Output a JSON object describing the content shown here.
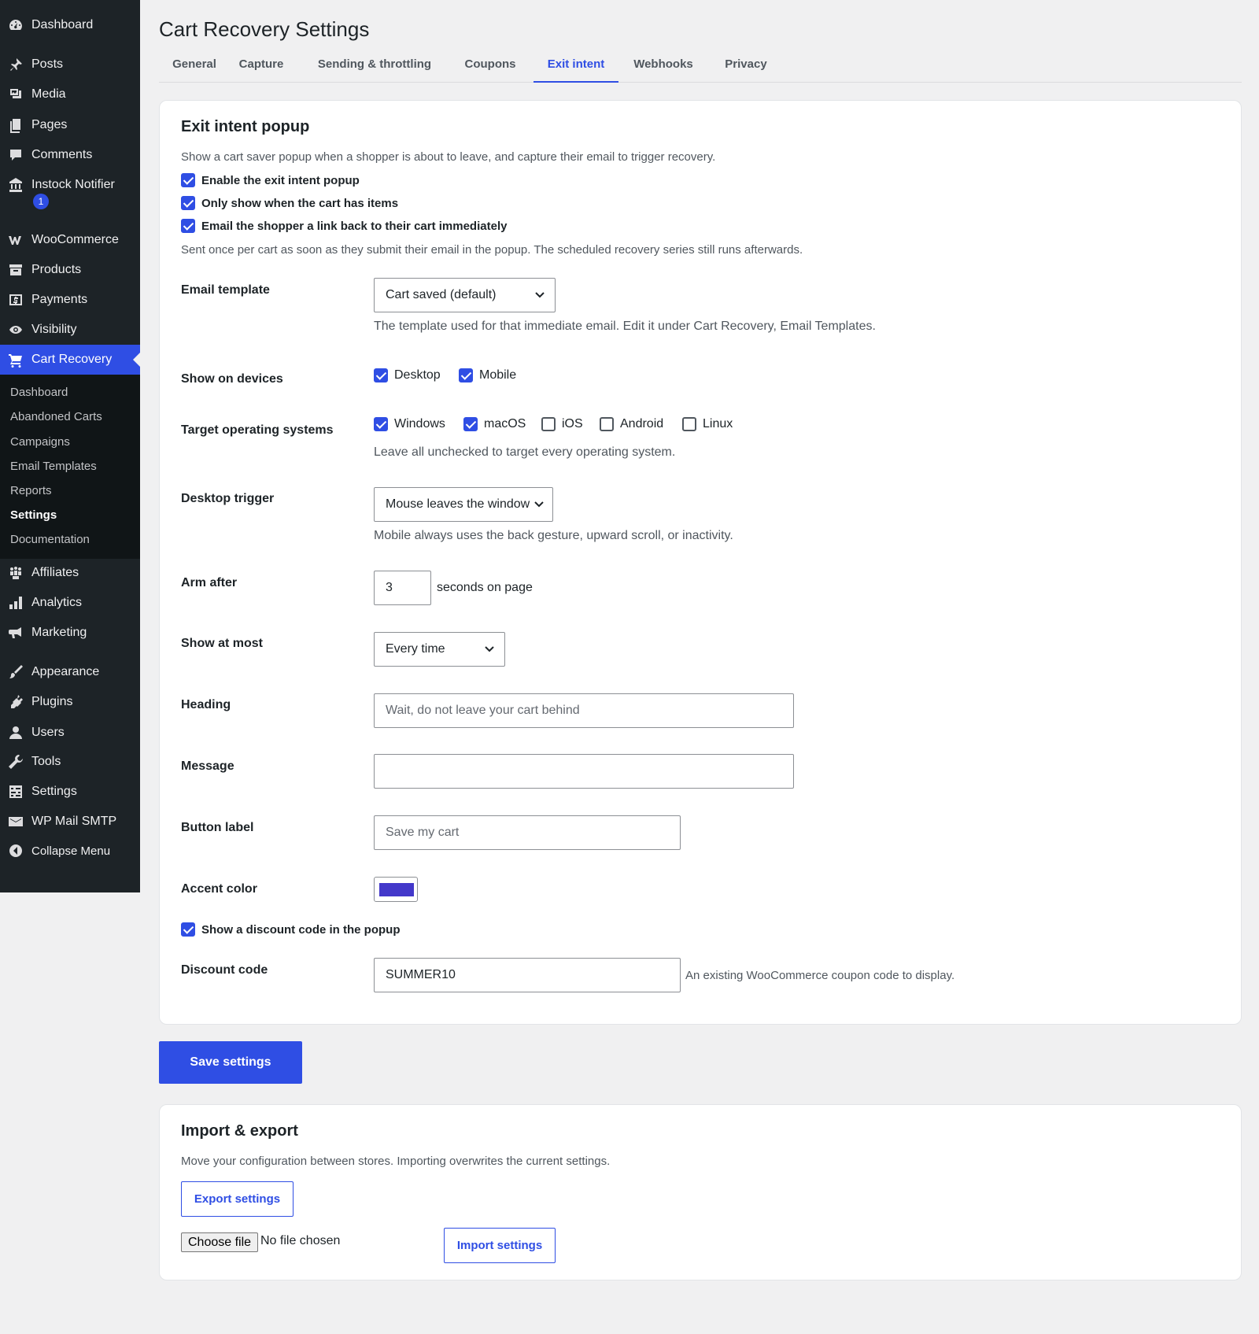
{
  "sidebar": {
    "items": [
      {
        "label": "Dashboard",
        "icon": "dashboard-icon"
      },
      {
        "label": "Posts",
        "icon": "pin-icon"
      },
      {
        "label": "Media",
        "icon": "media-icon"
      },
      {
        "label": "Pages",
        "icon": "pages-icon"
      },
      {
        "label": "Comments",
        "icon": "comment-icon"
      },
      {
        "label": "Instock Notifier",
        "icon": "bank-icon",
        "badge": "1"
      },
      {
        "label": "WooCommerce",
        "icon": "woo-icon"
      },
      {
        "label": "Products",
        "icon": "archive-icon"
      },
      {
        "label": "Payments",
        "icon": "money-icon"
      },
      {
        "label": "Visibility",
        "icon": "eye-icon"
      },
      {
        "label": "Cart Recovery",
        "icon": "cart-icon"
      },
      {
        "label": "Affiliates",
        "icon": "groups-icon"
      },
      {
        "label": "Analytics",
        "icon": "chart-bar-icon"
      },
      {
        "label": "Marketing",
        "icon": "megaphone-icon"
      },
      {
        "label": "Appearance",
        "icon": "brush-icon"
      },
      {
        "label": "Plugins",
        "icon": "plugin-icon"
      },
      {
        "label": "Users",
        "icon": "user-icon"
      },
      {
        "label": "Tools",
        "icon": "wrench-icon"
      },
      {
        "label": "Settings",
        "icon": "settings-icon"
      },
      {
        "label": "WP Mail SMTP",
        "icon": "mail-icon"
      },
      {
        "label": "Collapse Menu",
        "icon": "collapse-icon"
      }
    ],
    "submenu": [
      "Dashboard",
      "Abandoned Carts",
      "Campaigns",
      "Email Templates",
      "Reports",
      "Settings",
      "Documentation"
    ]
  },
  "page": {
    "title": "Cart Recovery Settings"
  },
  "tabs": [
    "General",
    "Capture",
    "Sending & throttling",
    "Coupons",
    "Exit intent",
    "Webhooks",
    "Privacy"
  ],
  "active_tab": "Exit intent",
  "exit": {
    "heading": "Exit intent popup",
    "intro": "Show a cart saver popup when a shopper is about to leave, and capture their email to trigger recovery.",
    "checks": [
      {
        "label": "Enable the exit intent popup",
        "checked": true
      },
      {
        "label": "Only show when the cart has items",
        "checked": true
      },
      {
        "label": "Email the shopper a link back to their cart immediately",
        "checked": true
      }
    ],
    "sent_note": "Sent once per cart as soon as they submit their email in the popup. The scheduled recovery series still runs afterwards.",
    "email_template": {
      "label": "Email template",
      "value": "Cart saved (default)",
      "help": "The template used for that immediate email. Edit it under Cart Recovery, Email Templates."
    },
    "devices": {
      "label": "Show on devices",
      "options": [
        {
          "label": "Desktop",
          "checked": true
        },
        {
          "label": "Mobile",
          "checked": true
        }
      ]
    },
    "os": {
      "label": "Target operating systems",
      "options": [
        {
          "label": "Windows",
          "checked": true
        },
        {
          "label": "macOS",
          "checked": true
        },
        {
          "label": "iOS",
          "checked": false
        },
        {
          "label": "Android",
          "checked": false
        },
        {
          "label": "Linux",
          "checked": false
        }
      ],
      "help": "Leave all unchecked to target every operating system."
    },
    "desktop_trigger": {
      "label": "Desktop trigger",
      "value": "Mouse leaves the window",
      "help": "Mobile always uses the back gesture, upward scroll, or inactivity."
    },
    "arm_after": {
      "label": "Arm after",
      "value": "3",
      "suffix": "seconds on page"
    },
    "show_at_most": {
      "label": "Show at most",
      "value": "Every time"
    },
    "heading_field": {
      "label": "Heading",
      "placeholder": "Wait, do not leave your cart behind"
    },
    "message_field": {
      "label": "Message",
      "placeholder": ""
    },
    "button_label_field": {
      "label": "Button label",
      "placeholder": "Save my cart"
    },
    "accent_color": {
      "label": "Accent color",
      "value": "#4338ca"
    },
    "discount_check": {
      "label": "Show a discount code in the popup",
      "checked": true
    },
    "discount_code": {
      "label": "Discount code",
      "value": "SUMMER10",
      "help": "An existing WooCommerce coupon code to display."
    }
  },
  "save_label": "Save settings",
  "import_export": {
    "heading": "Import & export",
    "desc": "Move your configuration between stores. Importing overwrites the current settings.",
    "export_label": "Export settings",
    "choose_file_label": "Choose file",
    "no_file": "No file chosen",
    "import_label": "Import settings"
  },
  "colors": {
    "accent": "#2f4ee4",
    "sidebar": "#1d2327",
    "background": "#f0f0f1"
  }
}
